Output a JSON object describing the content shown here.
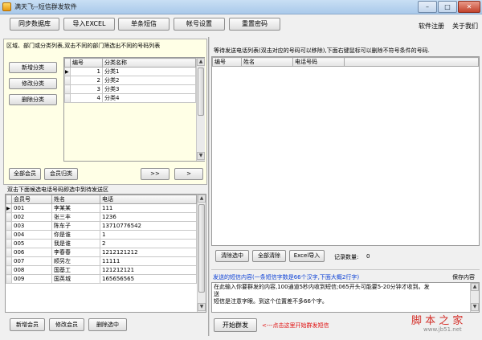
{
  "window": {
    "title": "满天飞--短信群发软件",
    "min": "–",
    "max": "□",
    "close": "✕"
  },
  "toolbar": {
    "buttons": [
      "同步数据库",
      "导入EXCEL",
      "单条短信",
      "帐号设置",
      "重置密码"
    ],
    "links": [
      "软件注册",
      "关于我们"
    ]
  },
  "category": {
    "hint": "区域、部门或分类列表,双击不同的部门筛选出不同的号码列表",
    "add": "新增分类",
    "edit": "修改分类",
    "delete": "删除分类",
    "columns": [
      "编号",
      "分类名称"
    ],
    "rows": [
      {
        "id": "1",
        "name": "分类1",
        "current": "▶"
      },
      {
        "id": "2",
        "name": "分类2",
        "current": ""
      },
      {
        "id": "3",
        "name": "分类3",
        "current": ""
      },
      {
        "id": "4",
        "name": "分类4",
        "current": ""
      }
    ],
    "all_members": "全部会员",
    "member_category": "会员归类",
    "add_all": ">>",
    "add_one": ">"
  },
  "members": {
    "hint": "双击下面候选电话号码即选中到待发送区",
    "columns": [
      "会员号",
      "姓名",
      "电话"
    ],
    "rows": [
      {
        "id": "001",
        "name": "李某某",
        "phone": "111",
        "current": "▶"
      },
      {
        "id": "002",
        "name": "张三丰",
        "phone": "1236",
        "current": ""
      },
      {
        "id": "003",
        "name": "陈车子",
        "phone": "13710776542",
        "current": ""
      },
      {
        "id": "004",
        "name": "你是谁",
        "phone": "1",
        "current": ""
      },
      {
        "id": "005",
        "name": "我是谁",
        "phone": "2",
        "current": ""
      },
      {
        "id": "006",
        "name": "李春春",
        "phone": "1212121212",
        "current": ""
      },
      {
        "id": "007",
        "name": "顺另左",
        "phone": "11111",
        "current": ""
      },
      {
        "id": "008",
        "name": "国基工",
        "phone": "121212121",
        "current": ""
      },
      {
        "id": "009",
        "name": "国英城",
        "phone": "165656565",
        "current": ""
      }
    ],
    "add": "新增会员",
    "edit": "修改会员",
    "delete": "删除选中"
  },
  "pending": {
    "hint": "等待发送电话列表(双击对应的号码可以移除),下面右键鼠标可以删除不符号条件的号码.",
    "columns": [
      "编号",
      "姓名",
      "电话号码"
    ],
    "clear_selected": "清除选中",
    "clear_all": "全部清除",
    "excel_import": "Excel导入",
    "count_label": "记录数量:",
    "count": "0"
  },
  "sms": {
    "label": "发送的短信内容(一条短信字数是66个汉字,下面大概2行字)",
    "save": "保存内容",
    "content": "在此输入你要群发的内容,100通道5秒内收到短信;065开头可能要5-20分钟才收到。发\n送\n短信是注意字眼。到这个位置差不多66个字。",
    "start": "开始群发",
    "start_hint": "<---点击这里开始群发短信"
  },
  "watermark": {
    "main": "脚 本 之 家",
    "sub": "www.jb51.net"
  }
}
